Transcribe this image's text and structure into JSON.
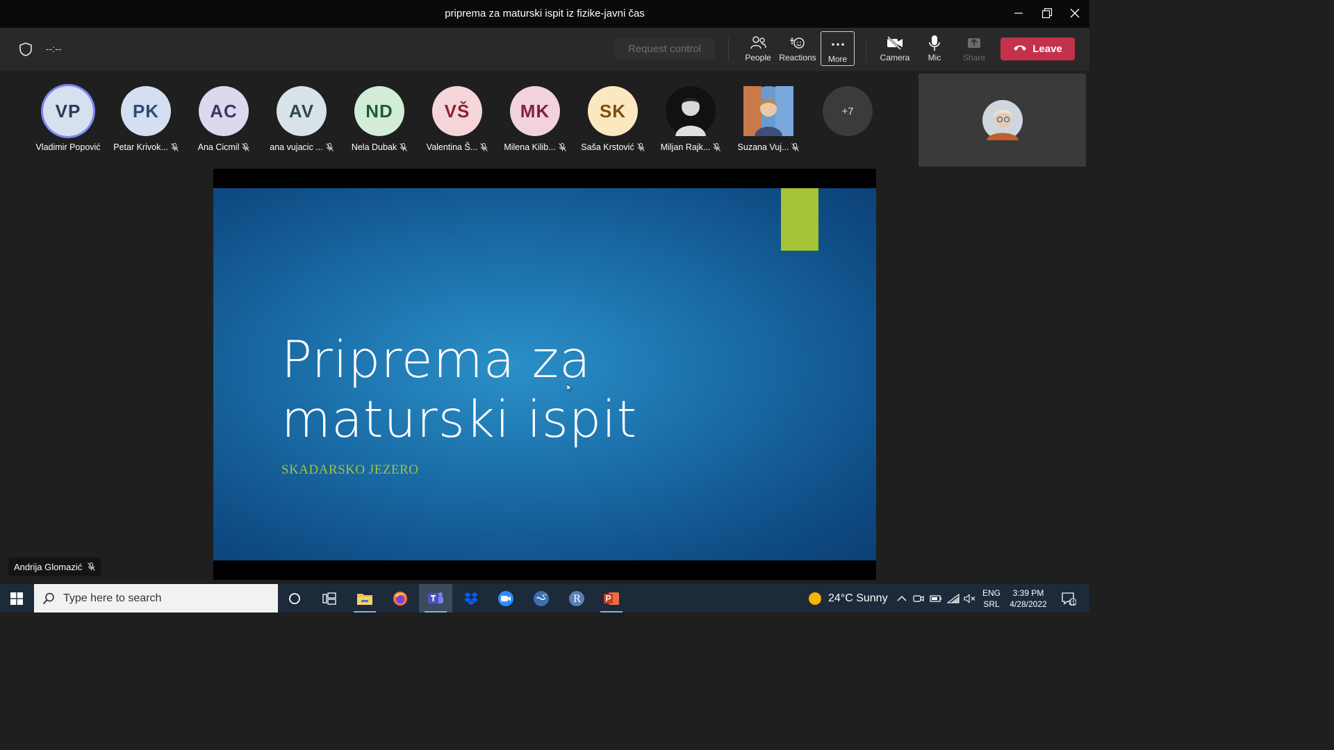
{
  "window": {
    "title": "priprema za maturski ispit iz fizike-javni čas"
  },
  "toolbar": {
    "timer": "--:--",
    "request_control": "Request control",
    "people": "People",
    "reactions": "Reactions",
    "more": "More",
    "camera": "Camera",
    "mic": "Mic",
    "share": "Share",
    "leave": "Leave"
  },
  "participants": [
    {
      "initials": "VP",
      "name": "Vladimir Popović",
      "bg": "#d6e0ee",
      "fg": "#2b3a55",
      "muted": false
    },
    {
      "initials": "PK",
      "name": "Petar Krivok...",
      "bg": "#d4e0f2",
      "fg": "#2f4a78",
      "muted": true
    },
    {
      "initials": "AC",
      "name": "Ana Cicmil",
      "bg": "#ddd8ec",
      "fg": "#3d3660",
      "muted": true
    },
    {
      "initials": "AV",
      "name": "ana vujacic ...",
      "bg": "#d8e3e8",
      "fg": "#2f4752",
      "muted": true
    },
    {
      "initials": "ND",
      "name": "Nela Dubak",
      "bg": "#d2ecd8",
      "fg": "#1f5a34",
      "muted": true
    },
    {
      "initials": "VŠ",
      "name": "Valentina Š...",
      "bg": "#f4d6da",
      "fg": "#8a2433",
      "muted": true
    },
    {
      "initials": "MK",
      "name": "Milena Kilib...",
      "bg": "#f2d3dc",
      "fg": "#7d2342",
      "muted": true
    },
    {
      "initials": "SK",
      "name": "Saša Krstović",
      "bg": "#fbe8c0",
      "fg": "#7a4e10",
      "muted": true
    },
    {
      "initials": "",
      "name": "Miljan Rajk...",
      "bg": "#1a1a1a",
      "fg": "#ffffff",
      "muted": true
    },
    {
      "initials": "",
      "name": "Suzana Vuj...",
      "bg": "#6a9bd0",
      "fg": "#ffffff",
      "muted": true
    }
  ],
  "overflow_count": "+7",
  "slide": {
    "title_line1": "Priprema za",
    "title_line2": "maturski ispit",
    "subtitle": "SKADARSKO JEZERO"
  },
  "presenter_name": "Andrija Glomazić",
  "taskbar": {
    "search_placeholder": "Type here to search",
    "weather": "24°C  Sunny",
    "lang_top": "ENG",
    "lang_bottom": "SRL",
    "time": "3:39 PM",
    "date": "4/28/2022",
    "notif_count": "11"
  }
}
